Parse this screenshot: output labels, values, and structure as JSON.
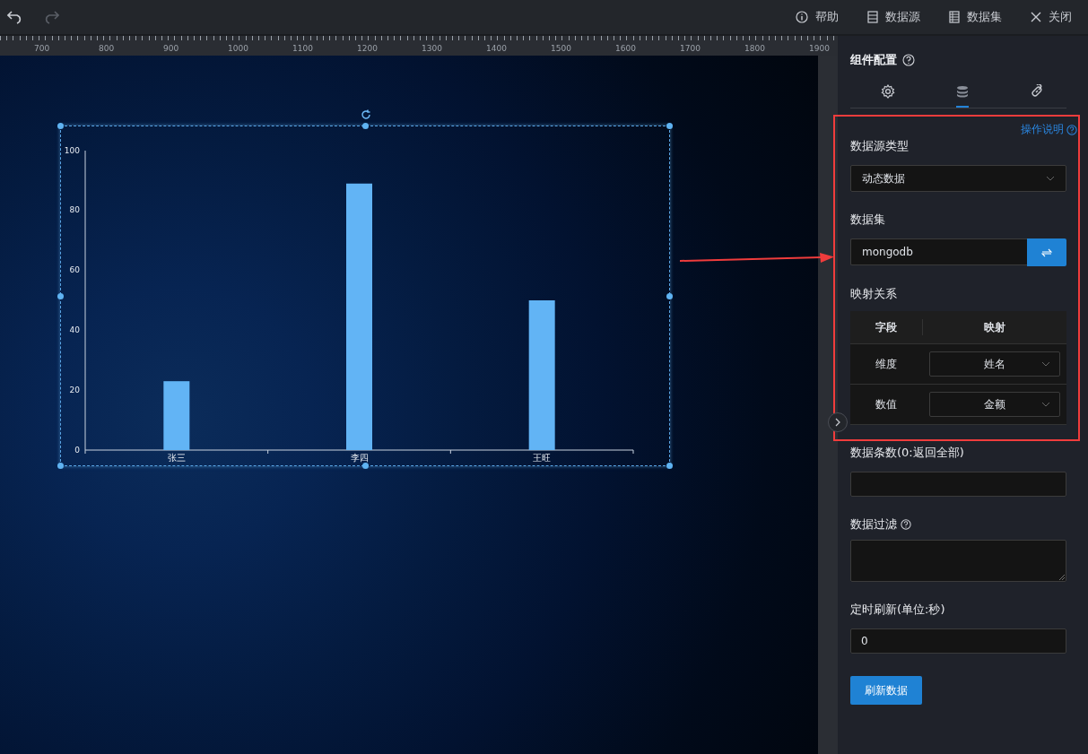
{
  "toolbar": {
    "undo": {
      "disabled": false
    },
    "redo": {
      "disabled": true
    },
    "items": [
      {
        "kind": "help",
        "label": "帮助"
      },
      {
        "kind": "datasource",
        "label": "数据源"
      },
      {
        "kind": "dataset",
        "label": "数据集"
      },
      {
        "kind": "close",
        "label": "关闭"
      }
    ]
  },
  "ruler": {
    "labels": [
      "700",
      "800",
      "900",
      "1000",
      "1100",
      "1200",
      "1300",
      "1400",
      "1500",
      "1600",
      "1700",
      "1800",
      "1900"
    ]
  },
  "canvas": {
    "chart_data": {
      "type": "bar",
      "categories": [
        "张三",
        "李四",
        "王旺"
      ],
      "values": [
        23,
        89,
        50
      ],
      "ylim": [
        0,
        100
      ],
      "yticks": [
        0,
        20,
        40,
        60,
        80,
        100
      ]
    }
  },
  "panel": {
    "title": "组件配置",
    "tabs": [
      {
        "kind": "settings",
        "selected": false
      },
      {
        "kind": "database",
        "selected": true
      },
      {
        "kind": "link",
        "selected": false
      }
    ],
    "help_link": "操作说明",
    "source_type": {
      "label": "数据源类型",
      "value": "动态数据"
    },
    "dataset": {
      "label": "数据集",
      "value": "mongodb"
    },
    "mapping": {
      "label": "映射关系",
      "columns": [
        "字段",
        "映射"
      ],
      "rows": [
        {
          "field": "维度",
          "value": "姓名"
        },
        {
          "field": "数值",
          "value": "金额"
        }
      ]
    },
    "fields": [
      {
        "kind": "input",
        "label": "数据条数(0:返回全部)",
        "help": false
      },
      {
        "kind": "textarea",
        "label": "数据过滤",
        "help": true
      },
      {
        "kind": "input",
        "label": "定时刷新(单位:秒)",
        "value": "0",
        "help": false
      }
    ],
    "button": "刷新数据"
  }
}
